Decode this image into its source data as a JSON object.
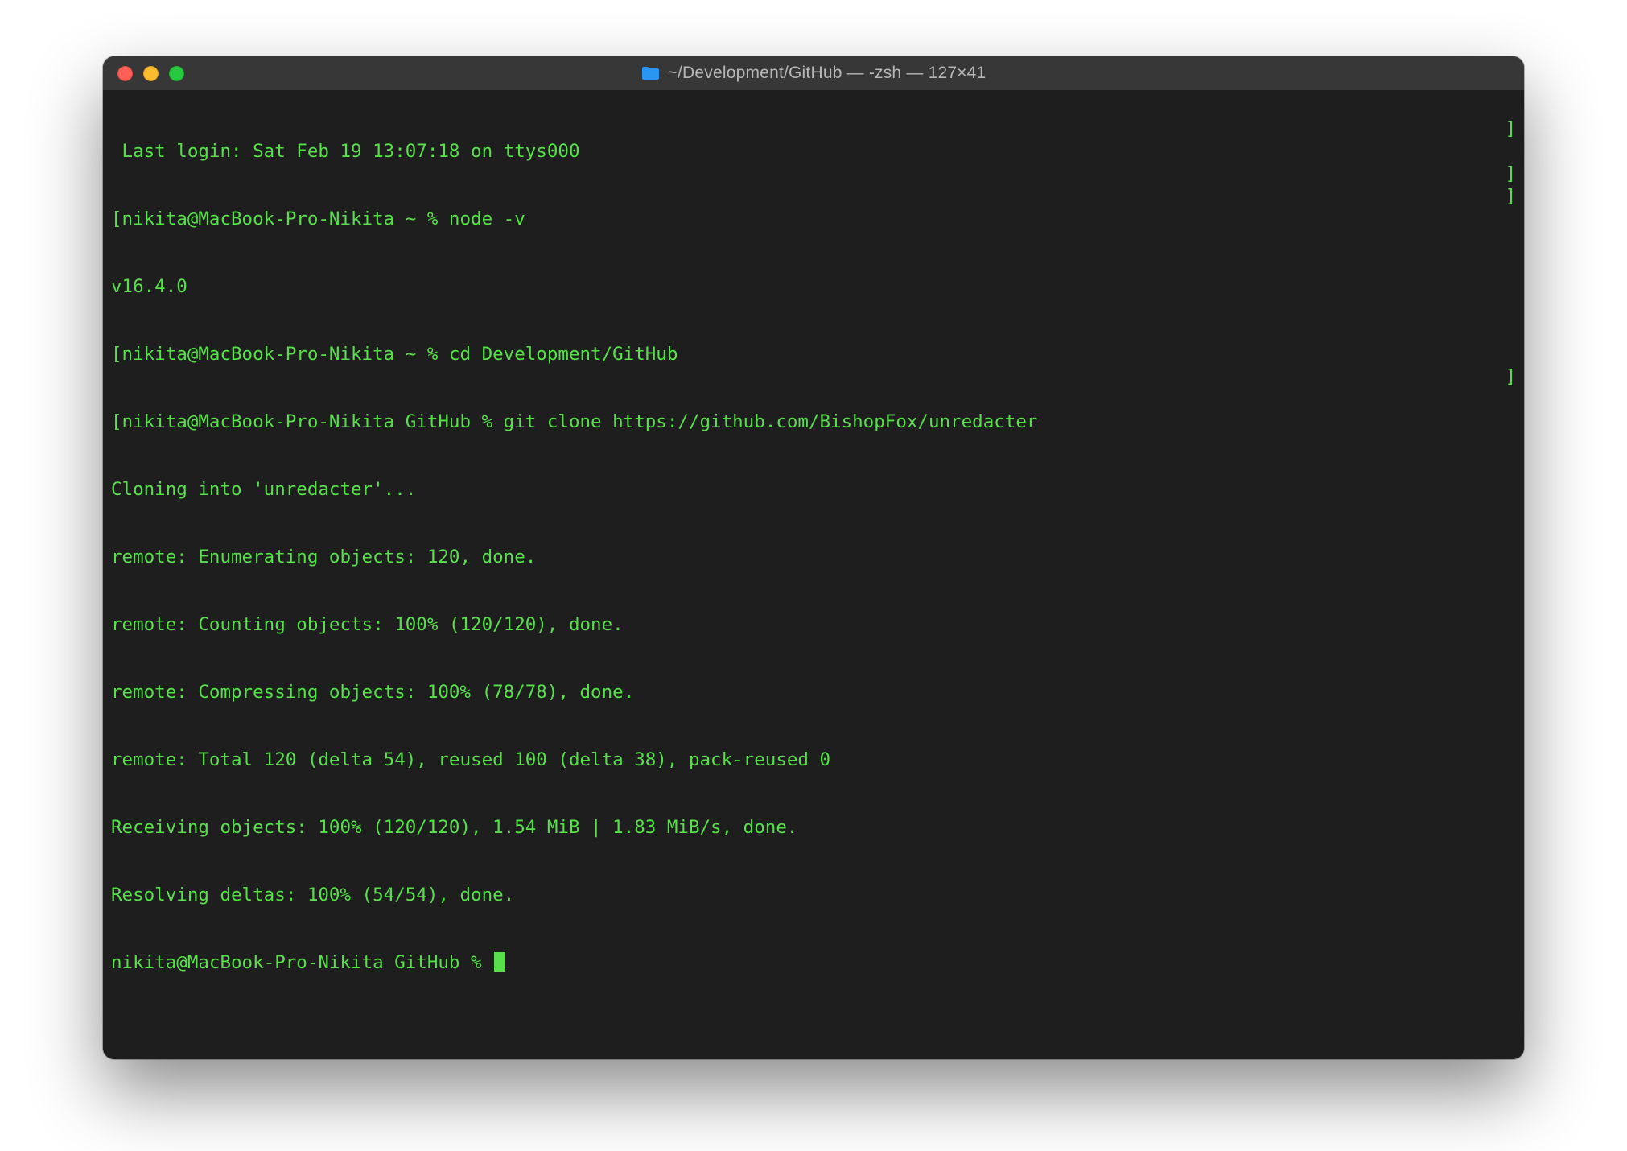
{
  "window": {
    "title": "~/Development/GitHub — -zsh — 127×41"
  },
  "terminal": {
    "lines": {
      "l0": " Last login: Sat Feb 19 13:07:18 on ttys000",
      "l1": "[nikita@MacBook-Pro-Nikita ~ % node -v",
      "l2": "v16.4.0",
      "l3": "[nikita@MacBook-Pro-Nikita ~ % cd Development/GitHub",
      "l4": "[nikita@MacBook-Pro-Nikita GitHub % git clone https://github.com/BishopFox/unredacter",
      "l5": "Cloning into 'unredacter'...",
      "l6": "remote: Enumerating objects: 120, done.",
      "l7": "remote: Counting objects: 100% (120/120), done.",
      "l8": "remote: Compressing objects: 100% (78/78), done.",
      "l9": "remote: Total 120 (delta 54), reused 100 (delta 38), pack-reused 0",
      "l10": "Receiving objects: 100% (120/120), 1.54 MiB | 1.83 MiB/s, done.",
      "l11": "Resolving deltas: 100% (54/54), done.",
      "l12": "nikita@MacBook-Pro-Nikita GitHub % "
    },
    "right_bracket": "]"
  }
}
